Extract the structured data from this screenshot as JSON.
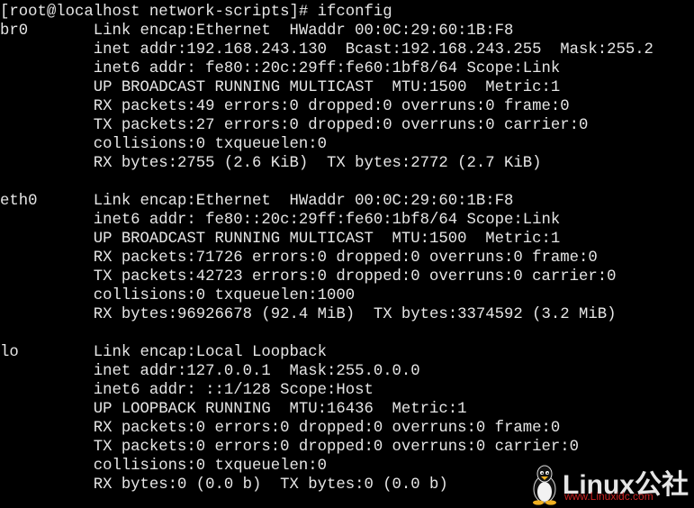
{
  "terminal": {
    "lines": [
      "[root@localhost network-scripts]# ifconfig",
      "br0       Link encap:Ethernet  HWaddr 00:0C:29:60:1B:F8",
      "          inet addr:192.168.243.130  Bcast:192.168.243.255  Mask:255.2",
      "          inet6 addr: fe80::20c:29ff:fe60:1bf8/64 Scope:Link",
      "          UP BROADCAST RUNNING MULTICAST  MTU:1500  Metric:1",
      "          RX packets:49 errors:0 dropped:0 overruns:0 frame:0",
      "          TX packets:27 errors:0 dropped:0 overruns:0 carrier:0",
      "          collisions:0 txqueuelen:0",
      "          RX bytes:2755 (2.6 KiB)  TX bytes:2772 (2.7 KiB)",
      "",
      "eth0      Link encap:Ethernet  HWaddr 00:0C:29:60:1B:F8",
      "          inet6 addr: fe80::20c:29ff:fe60:1bf8/64 Scope:Link",
      "          UP BROADCAST RUNNING MULTICAST  MTU:1500  Metric:1",
      "          RX packets:71726 errors:0 dropped:0 overruns:0 frame:0",
      "          TX packets:42723 errors:0 dropped:0 overruns:0 carrier:0",
      "          collisions:0 txqueuelen:1000",
      "          RX bytes:96926678 (92.4 MiB)  TX bytes:3374592 (3.2 MiB)",
      "",
      "lo        Link encap:Local Loopback",
      "          inet addr:127.0.0.1  Mask:255.0.0.0",
      "          inet6 addr: ::1/128 Scope:Host",
      "          UP LOOPBACK RUNNING  MTU:16436  Metric:1",
      "          RX packets:0 errors:0 dropped:0 overruns:0 frame:0",
      "          TX packets:0 errors:0 dropped:0 overruns:0 carrier:0",
      "          collisions:0 txqueuelen:0",
      "          RX bytes:0 (0.0 b)  TX bytes:0 (0.0 b)"
    ]
  },
  "watermark": {
    "logo_text": "Linux公社",
    "url_text": "www.Linuxidc.com"
  },
  "colors": {
    "background": "#000000",
    "text": "#e6e6e6",
    "watermark_url": "#cc2222"
  }
}
